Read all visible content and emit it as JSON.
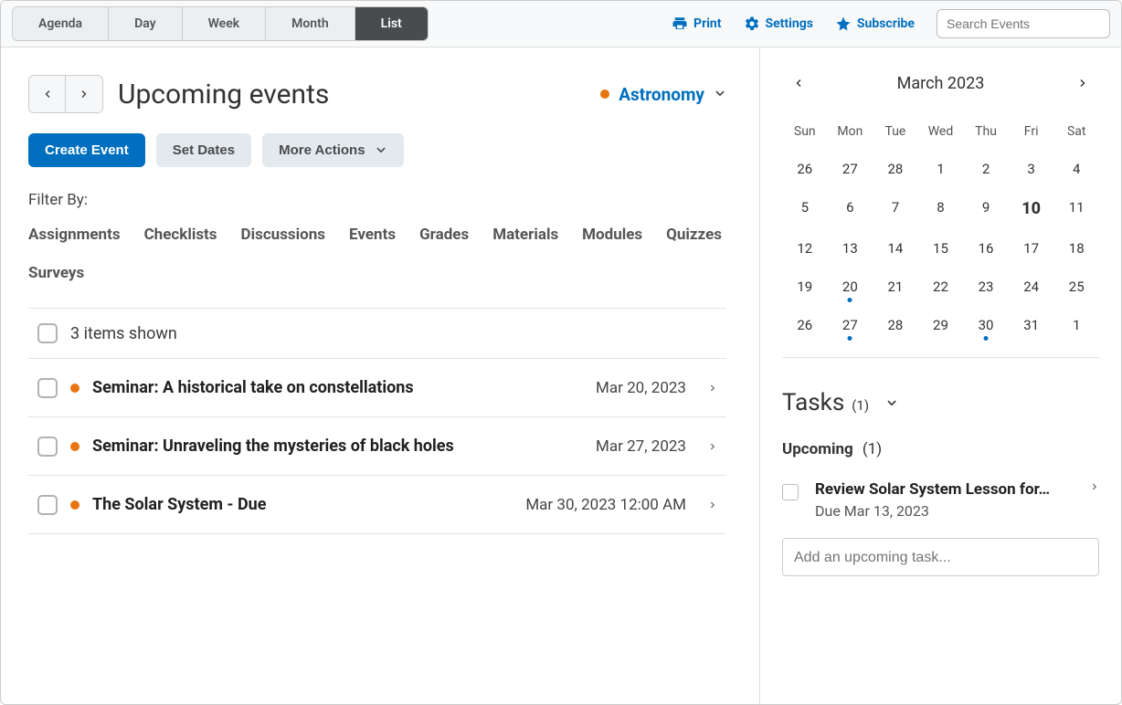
{
  "topbar": {
    "tabs": [
      "Agenda",
      "Day",
      "Week",
      "Month",
      "List"
    ],
    "activeTab": "List",
    "print": "Print",
    "settings": "Settings",
    "subscribe": "Subscribe",
    "searchPlaceholder": "Search Events"
  },
  "header": {
    "title": "Upcoming events",
    "courseName": "Astronomy",
    "courseColor": "#e87511"
  },
  "buttons": {
    "create": "Create Event",
    "setDates": "Set Dates",
    "moreActions": "More Actions"
  },
  "filter": {
    "label": "Filter By:",
    "items": [
      "Assignments",
      "Checklists",
      "Discussions",
      "Events",
      "Grades",
      "Materials",
      "Modules",
      "Quizzes",
      "Surveys"
    ]
  },
  "list": {
    "countText": "3 items shown",
    "items": [
      {
        "title": "Seminar: A historical take on constellations",
        "date": "Mar 20, 2023"
      },
      {
        "title": "Seminar: Unraveling the mysteries of black holes",
        "date": "Mar 27, 2023"
      },
      {
        "title": "The Solar System - Due",
        "date": "Mar 30, 2023 12:00 AM"
      }
    ]
  },
  "miniCal": {
    "monthLabel": "March 2023",
    "dow": [
      "Sun",
      "Mon",
      "Tue",
      "Wed",
      "Thu",
      "Fri",
      "Sat"
    ],
    "weeks": [
      [
        {
          "d": 26
        },
        {
          "d": 27
        },
        {
          "d": 28
        },
        {
          "d": 1
        },
        {
          "d": 2
        },
        {
          "d": 3
        },
        {
          "d": 4
        }
      ],
      [
        {
          "d": 5
        },
        {
          "d": 6
        },
        {
          "d": 7
        },
        {
          "d": 8
        },
        {
          "d": 9
        },
        {
          "d": 10,
          "today": true
        },
        {
          "d": 11
        }
      ],
      [
        {
          "d": 12
        },
        {
          "d": 13
        },
        {
          "d": 14
        },
        {
          "d": 15
        },
        {
          "d": 16
        },
        {
          "d": 17
        },
        {
          "d": 18
        }
      ],
      [
        {
          "d": 19
        },
        {
          "d": 20,
          "dot": true
        },
        {
          "d": 21
        },
        {
          "d": 22
        },
        {
          "d": 23
        },
        {
          "d": 24
        },
        {
          "d": 25
        }
      ],
      [
        {
          "d": 26
        },
        {
          "d": 27,
          "dot": true
        },
        {
          "d": 28
        },
        {
          "d": 29
        },
        {
          "d": 30,
          "dot": true
        },
        {
          "d": 31
        },
        {
          "d": 1
        }
      ]
    ]
  },
  "tasks": {
    "title": "Tasks",
    "count": "(1)",
    "subTitle": "Upcoming",
    "subCount": "(1)",
    "items": [
      {
        "name": "Review Solar System Lesson for…",
        "due": "Due Mar 13, 2023"
      }
    ],
    "addPlaceholder": "Add an upcoming task..."
  }
}
